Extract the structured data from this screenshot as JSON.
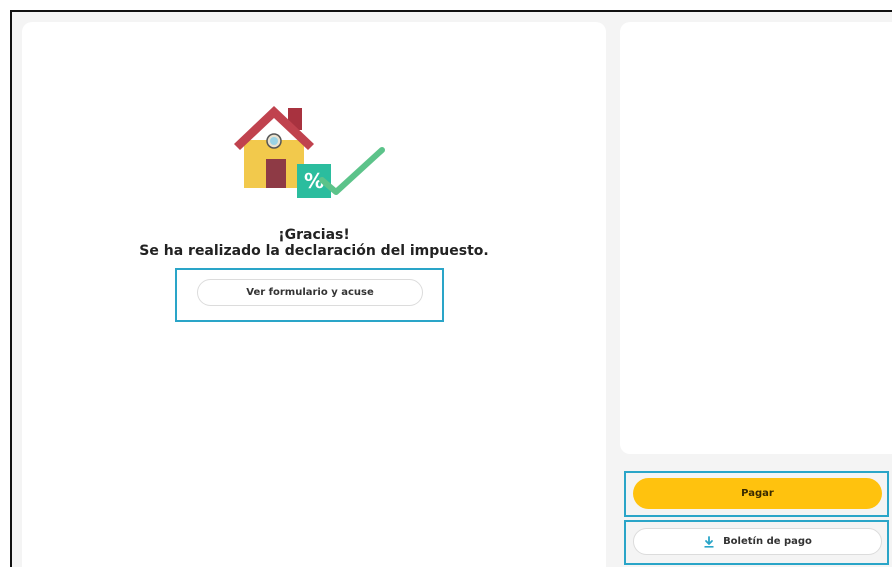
{
  "confirmation": {
    "thanks": "¡Gracias!",
    "message": "Se ha realizado la declaración del impuesto.",
    "illustration_icon": "house-percent-check-icon",
    "view_form_label": "Ver formulario y acuse"
  },
  "payment": {
    "pay_label": "Pagar",
    "slip_label": "Boletín de pago",
    "slip_icon": "download-icon"
  },
  "colors": {
    "accent_yellow": "#ffc20e",
    "highlight": "#2aa5c8",
    "check_green": "#5cc38a",
    "percent_teal": "#2bbd9e",
    "roof_red": "#c0424e",
    "house_yellow": "#f2c94c",
    "door_maroon": "#8e3a45"
  }
}
